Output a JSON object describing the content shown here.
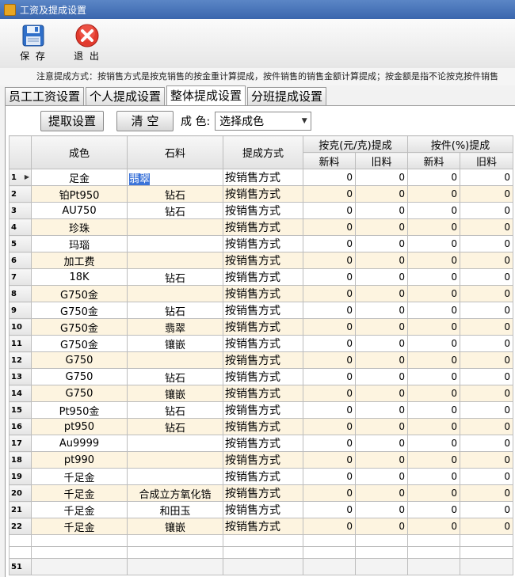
{
  "window": {
    "title": "工资及提成设置"
  },
  "toolbar": {
    "save_label": "保 存",
    "exit_label": "退 出"
  },
  "notice": "注意提成方式：按销售方式是按克销售的按金重计算提成，按件销售的销售金额计算提成；按金额是指不论按克按件销售",
  "tabs": [
    "员工工资设置",
    "个人提成设置",
    "整体提成设置",
    "分班提成设置"
  ],
  "actions": {
    "fetch_label": "提取设置",
    "clear_label": "清  空",
    "color_label": "成 色:",
    "color_value": "选择成色"
  },
  "columns": {
    "color": "成色",
    "stone": "石料",
    "method": "提成方式",
    "per_gram": "按克(元/克)提成",
    "per_piece": "按件(%)提成",
    "new": "新料",
    "old": "旧料"
  },
  "rows": [
    {
      "no": "1",
      "color": "足金",
      "stone": "翡翠",
      "method": "按销售方式",
      "a": "0",
      "b": "0",
      "c": "0",
      "d": "0"
    },
    {
      "no": "2",
      "color": "铂Pt950",
      "stone": "钻石",
      "method": "按销售方式",
      "a": "0",
      "b": "0",
      "c": "0",
      "d": "0"
    },
    {
      "no": "3",
      "color": "AU750",
      "stone": "钻石",
      "method": "按销售方式",
      "a": "0",
      "b": "0",
      "c": "0",
      "d": "0"
    },
    {
      "no": "4",
      "color": "珍珠",
      "stone": "",
      "method": "按销售方式",
      "a": "0",
      "b": "0",
      "c": "0",
      "d": "0"
    },
    {
      "no": "5",
      "color": "玛瑙",
      "stone": "",
      "method": "按销售方式",
      "a": "0",
      "b": "0",
      "c": "0",
      "d": "0"
    },
    {
      "no": "6",
      "color": "加工费",
      "stone": "",
      "method": "按销售方式",
      "a": "0",
      "b": "0",
      "c": "0",
      "d": "0"
    },
    {
      "no": "7",
      "color": "18K",
      "stone": "钻石",
      "method": "按销售方式",
      "a": "0",
      "b": "0",
      "c": "0",
      "d": "0"
    },
    {
      "no": "8",
      "color": "G750金",
      "stone": "",
      "method": "按销售方式",
      "a": "0",
      "b": "0",
      "c": "0",
      "d": "0"
    },
    {
      "no": "9",
      "color": "G750金",
      "stone": "钻石",
      "method": "按销售方式",
      "a": "0",
      "b": "0",
      "c": "0",
      "d": "0"
    },
    {
      "no": "10",
      "color": "G750金",
      "stone": "翡翠",
      "method": "按销售方式",
      "a": "0",
      "b": "0",
      "c": "0",
      "d": "0"
    },
    {
      "no": "11",
      "color": "G750金",
      "stone": "镶嵌",
      "method": "按销售方式",
      "a": "0",
      "b": "0",
      "c": "0",
      "d": "0"
    },
    {
      "no": "12",
      "color": "G750",
      "stone": "",
      "method": "按销售方式",
      "a": "0",
      "b": "0",
      "c": "0",
      "d": "0"
    },
    {
      "no": "13",
      "color": "G750",
      "stone": "钻石",
      "method": "按销售方式",
      "a": "0",
      "b": "0",
      "c": "0",
      "d": "0"
    },
    {
      "no": "14",
      "color": "G750",
      "stone": "镶嵌",
      "method": "按销售方式",
      "a": "0",
      "b": "0",
      "c": "0",
      "d": "0"
    },
    {
      "no": "15",
      "color": "Pt950金",
      "stone": "钻石",
      "method": "按销售方式",
      "a": "0",
      "b": "0",
      "c": "0",
      "d": "0"
    },
    {
      "no": "16",
      "color": "pt950",
      "stone": "钻石",
      "method": "按销售方式",
      "a": "0",
      "b": "0",
      "c": "0",
      "d": "0"
    },
    {
      "no": "17",
      "color": "Au9999",
      "stone": "",
      "method": "按销售方式",
      "a": "0",
      "b": "0",
      "c": "0",
      "d": "0"
    },
    {
      "no": "18",
      "color": "pt990",
      "stone": "",
      "method": "按销售方式",
      "a": "0",
      "b": "0",
      "c": "0",
      "d": "0"
    },
    {
      "no": "19",
      "color": "千足金",
      "stone": "",
      "method": "按销售方式",
      "a": "0",
      "b": "0",
      "c": "0",
      "d": "0"
    },
    {
      "no": "20",
      "color": "千足金",
      "stone": "合成立方氧化锆",
      "method": "按销售方式",
      "a": "0",
      "b": "0",
      "c": "0",
      "d": "0"
    },
    {
      "no": "21",
      "color": "千足金",
      "stone": "和田玉",
      "method": "按销售方式",
      "a": "0",
      "b": "0",
      "c": "0",
      "d": "0"
    },
    {
      "no": "22",
      "color": "千足金",
      "stone": "镶嵌",
      "method": "按销售方式",
      "a": "0",
      "b": "0",
      "c": "0",
      "d": "0"
    }
  ],
  "footer": {
    "count": "51"
  }
}
